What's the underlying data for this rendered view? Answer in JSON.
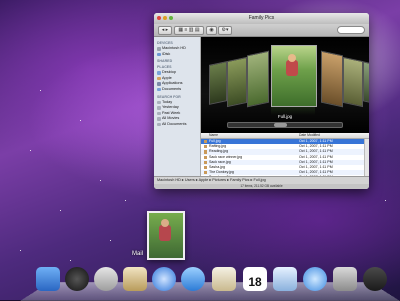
{
  "window": {
    "title": "Family Pics",
    "coverflow_title": "Full.jpg",
    "path": "Macintosh HD ▸ Users ▸ Apple ▸ Pictures ▸ Family Pics ▸ Full.jpg",
    "status": "17 items, 211.52 GB available"
  },
  "sidebar": {
    "devices_header": "DEVICES",
    "devices": [
      "Macintosh HD",
      "iDisk"
    ],
    "shared_header": "SHARED",
    "places_header": "PLACES",
    "places": [
      "Desktop",
      "Apple",
      "Applications",
      "Documents"
    ],
    "search_header": "SEARCH FOR",
    "search": [
      "Today",
      "Yesterday",
      "Past Week",
      "All Movies",
      "All Documents"
    ]
  },
  "list": {
    "col_name": "Name",
    "col_date": "Date Modified",
    "rows": [
      {
        "name": "Full.jpg",
        "date": "Oct 1, 2007, 1:11 PM"
      },
      {
        "name": "Rafting.jpg",
        "date": "Oct 1, 2007, 1:11 PM"
      },
      {
        "name": "Reading.jpg",
        "date": "Oct 1, 2007, 1:11 PM"
      },
      {
        "name": "Sack race winner.jpg",
        "date": "Oct 1, 2007, 1:11 PM"
      },
      {
        "name": "Sack race.jpg",
        "date": "Oct 1, 2007, 1:11 PM"
      },
      {
        "name": "Sasha.jpg",
        "date": "Oct 1, 2007, 1:11 PM"
      },
      {
        "name": "The Donkey.jpg",
        "date": "Oct 1, 2007, 1:11 PM"
      },
      {
        "name": "Tug o' war 2.jpg",
        "date": "Oct 1, 2007, 1:11 PM"
      },
      {
        "name": "Tug o' war.jpg",
        "date": "Oct 1, 2007, 1:11 PM"
      }
    ]
  },
  "drag": {
    "label": "Mail"
  },
  "dock": {
    "icons": [
      "finder-icon",
      "dashboard-icon",
      "mail-icon",
      "time-machine-icon",
      "preview-icon",
      "safari-icon",
      "ichat-icon",
      "address-book-icon",
      "ical-icon",
      "iphoto-icon",
      "itunes-icon",
      "photo-booth-icon",
      "imovie-icon"
    ],
    "ical_day": "18"
  },
  "colors": {
    "selection": "#3875d7",
    "accent_blue": "#3b7be0"
  }
}
